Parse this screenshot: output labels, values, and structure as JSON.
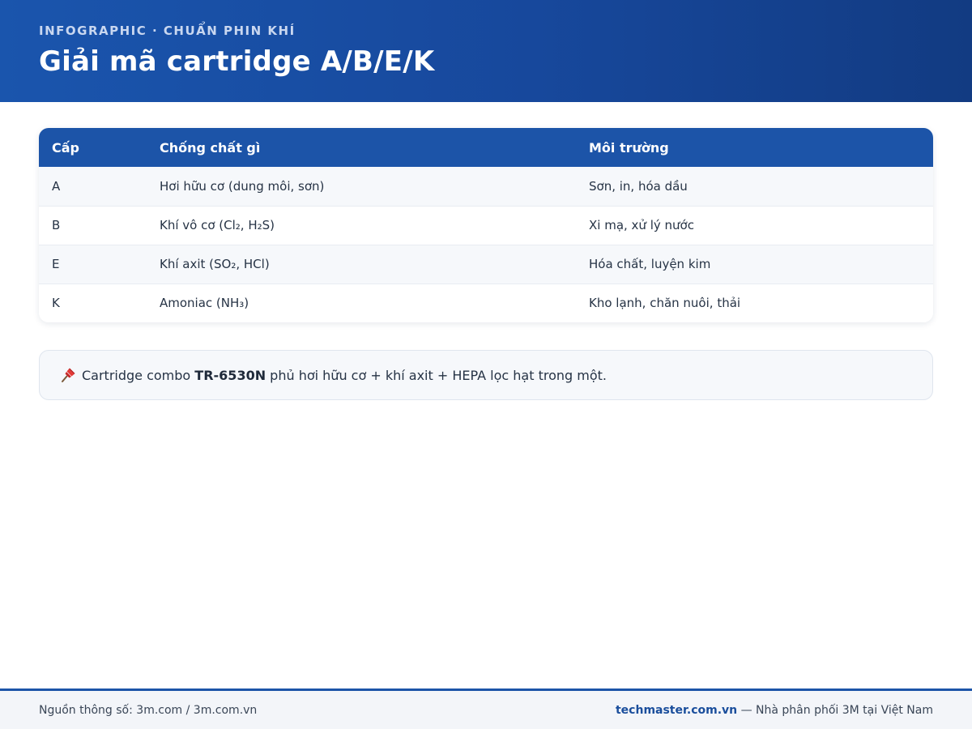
{
  "header": {
    "eyebrow": "INFOGRAPHIC · CHUẨN PHIN KHÍ",
    "title": "Giải mã cartridge A/B/E/K"
  },
  "table": {
    "headers": [
      "Cấp",
      "Chống chất gì",
      "Môi trường"
    ],
    "rows": [
      {
        "grade": "A",
        "against": "Hơi hữu cơ (dung môi, sơn)",
        "environment": "Sơn, in, hóa dầu"
      },
      {
        "grade": "B",
        "against": "Khí vô cơ (Cl₂, H₂S)",
        "environment": "Xi mạ, xử lý nước"
      },
      {
        "grade": "E",
        "against": "Khí axit (SO₂, HCl)",
        "environment": "Hóa chất, luyện kim"
      },
      {
        "grade": "K",
        "against": "Amoniac (NH₃)",
        "environment": "Kho lạnh, chăn nuôi, thải"
      }
    ]
  },
  "note": {
    "icon": "pushpin-icon",
    "prefix": "Cartridge combo ",
    "product": "TR-6530N",
    "suffix": " phủ hơi hữu cơ + khí axit + HEPA lọc hạt trong một."
  },
  "footer": {
    "source": "Nguồn thông số: 3m.com / 3m.com.vn",
    "site": "techmaster.com.vn",
    "tagline": " — Nhà phân phối 3M tại Việt Nam"
  }
}
